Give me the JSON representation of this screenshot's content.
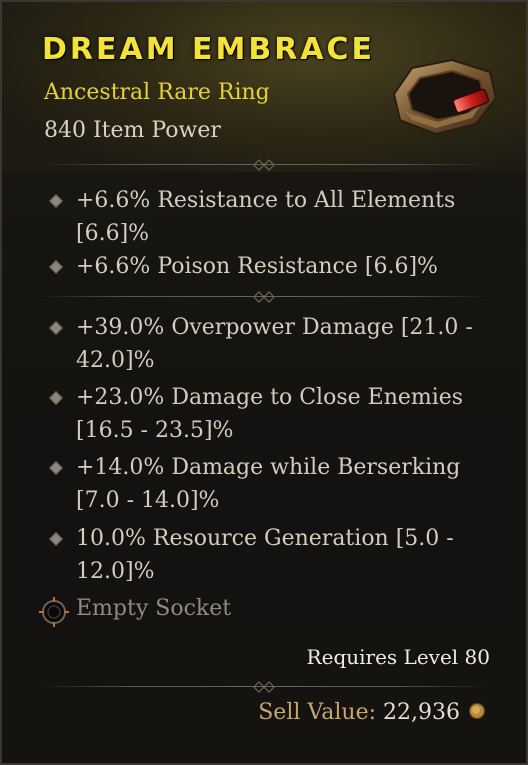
{
  "item": {
    "name": "DREAM EMBRACE",
    "type": "Ancestral Rare Ring",
    "power": "840 Item Power",
    "icon": "ring-icon"
  },
  "implicit_affixes": [
    {
      "line1": "+6.6% Resistance to All Elements",
      "line2": "[6.6]%"
    },
    {
      "line1": "+6.6% Poison Resistance [6.6]%",
      "line2": ""
    }
  ],
  "affixes": [
    {
      "line1": "+39.0% Overpower Damage [21.0 -",
      "line2": "42.0]%"
    },
    {
      "line1": "+23.0% Damage to Close Enemies",
      "line2": "[16.5 - 23.5]%"
    },
    {
      "line1": "+14.0% Damage while Berserking",
      "line2": "[7.0 - 14.0]%"
    },
    {
      "line1": "10.0% Resource Generation [5.0 -",
      "line2": "12.0]%"
    }
  ],
  "socket": {
    "label": "Empty Socket",
    "icon": "socket-icon"
  },
  "requirements": {
    "text": "Requires Level 80"
  },
  "sell": {
    "label": "Sell Value:",
    "value": "22,936",
    "icon": "gold-coin-icon"
  },
  "colors": {
    "title": "#f2e23a",
    "rare": "#e3d238",
    "affix_text": "#d4cdbf",
    "sell_label": "#c8a66e",
    "socket_text": "#908a80"
  }
}
